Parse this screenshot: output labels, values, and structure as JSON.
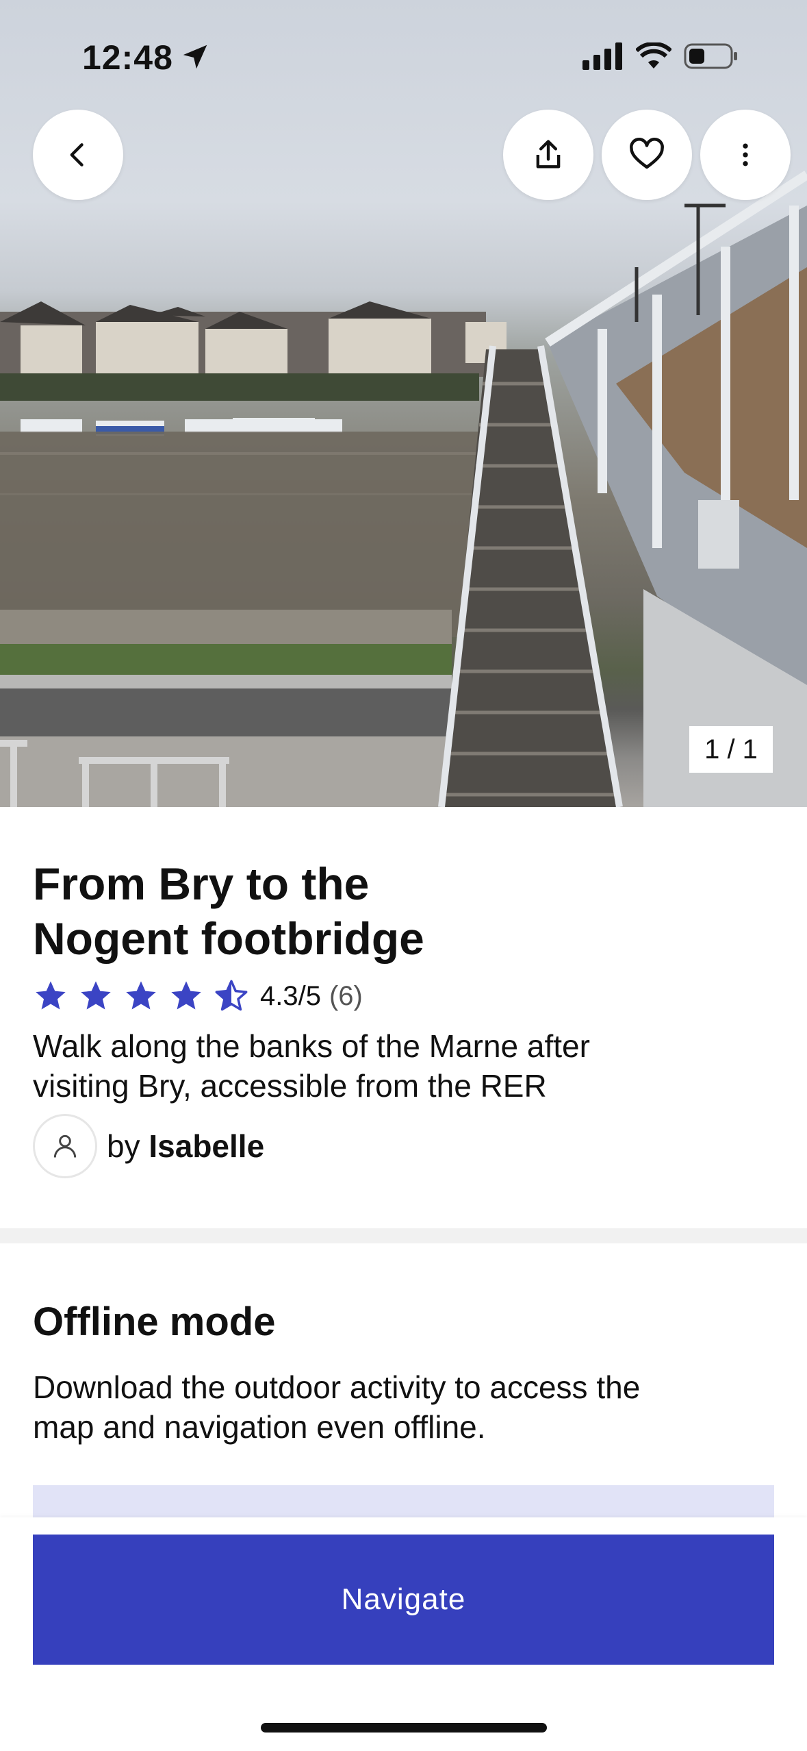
{
  "status_bar": {
    "time": "12:48"
  },
  "photo": {
    "counter": "1 / 1"
  },
  "route": {
    "title_line1": "From Bry to the",
    "title_line2": "Nogent footbridge",
    "rating": 4.3,
    "rating_text": "4.3/5",
    "review_count": "(6)",
    "description_line1": "Walk along the banks of the Marne after",
    "description_line2": "visiting Bry, accessible from the RER",
    "author_prefix": "by",
    "author_name": "Isabelle"
  },
  "offline": {
    "heading": "Offline mode",
    "text_line1": "Download the outdoor activity to access the",
    "text_line2": "map and navigation even offline."
  },
  "actions": {
    "navigate_label": "Navigate"
  },
  "colors": {
    "accent": "#3640bd",
    "star": "#3b44c4",
    "offline_card": "#e1e3f7"
  },
  "icons": [
    "back-arrow-icon",
    "share-icon",
    "heart-icon",
    "more-vertical-icon",
    "star-icon",
    "half-star-icon",
    "user-icon",
    "location-arrow-icon",
    "signal-icon",
    "wifi-icon",
    "battery-icon"
  ]
}
